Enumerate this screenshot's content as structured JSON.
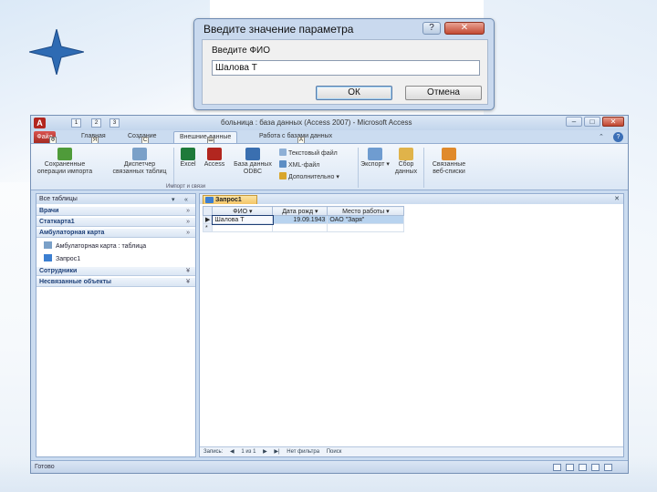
{
  "dialog": {
    "title": "Введите значение параметра",
    "help_label": "?",
    "close_label": "✕",
    "prompt": "Введите ФИО",
    "input_value": "Шалова Т",
    "ok_label": "ОК",
    "cancel_label": "Отмена"
  },
  "window": {
    "title": "больница : база данных (Access 2007) - Microsoft Access",
    "logo": "A",
    "min_label": "–",
    "max_label": "□",
    "close_label": "✕",
    "qat": [
      "1",
      "2",
      "3"
    ]
  },
  "tabs": {
    "office": "Файл",
    "items": [
      "Главная",
      "Создание",
      "Внешние данные",
      "Работа с базами данных"
    ],
    "active": "Внешние данные",
    "keytips": [
      "Ф",
      "Я",
      "С",
      "Ш",
      "А"
    ]
  },
  "ribbon": {
    "big": [
      {
        "label": "Сохраненные операции импорта",
        "icon": "saved-imports-icon",
        "color": "#4f9b3a"
      },
      {
        "label": "Диспетчер связанных таблиц",
        "icon": "linked-table-manager-icon",
        "color": "#7aa0c8"
      },
      {
        "label": "Excel",
        "icon": "excel-icon",
        "color": "#1f7a3a"
      },
      {
        "label": "Access",
        "icon": "access-icon",
        "color": "#b2261f"
      },
      {
        "label": "База данных ODBC",
        "icon": "odbc-icon",
        "color": "#3a6fb0"
      }
    ],
    "small": [
      {
        "label": "Текстовый файл",
        "icon": "text-file-icon"
      },
      {
        "label": "XML-файл",
        "icon": "xml-file-icon"
      },
      {
        "label": "Дополнительно ▾",
        "icon": "more-icon"
      }
    ],
    "export": {
      "label": "Экспорт ▾",
      "icon": "export-icon"
    },
    "collect": {
      "label": "Сбор данных",
      "icon": "collect-data-icon"
    },
    "sharepoint": {
      "label": "Связанные веб-списки",
      "icon": "sharepoint-icon"
    },
    "group_import": "Импорт и связи"
  },
  "nav": {
    "header": "Все таблицы",
    "groups": [
      {
        "label": "Врачи",
        "chevron": "»"
      },
      {
        "label": "Статкарта1",
        "chevron": "»"
      },
      {
        "label": "Амбулаторная карта",
        "chevron": "»"
      },
      {
        "label": "Сотрудники",
        "chevron": "¥"
      },
      {
        "label": "Несвязанные объекты",
        "chevron": "¥"
      }
    ],
    "items": [
      {
        "label": "Амбулаторная карта : таблица",
        "icon": "table-icon"
      },
      {
        "label": "Запрос1",
        "icon": "query-icon"
      }
    ],
    "header_btn1": "▾",
    "header_btn2": "«"
  },
  "doc": {
    "tab_label": "Запрос1",
    "close_label": "✕",
    "columns": [
      "ФИО",
      "Дата рожд",
      "Место работы"
    ],
    "rows": [
      {
        "fio": "Шалова Т",
        "date": "19.09.1943",
        "work": "ОАО \"Заря\""
      }
    ],
    "new_row_marker": "*",
    "row_marker": "▶",
    "record_nav": [
      "Запись:",
      "◀",
      "1 из 1",
      "▶",
      "▶|",
      "Нет фильтра",
      "Поиск"
    ]
  },
  "status": {
    "text": "Готово"
  }
}
